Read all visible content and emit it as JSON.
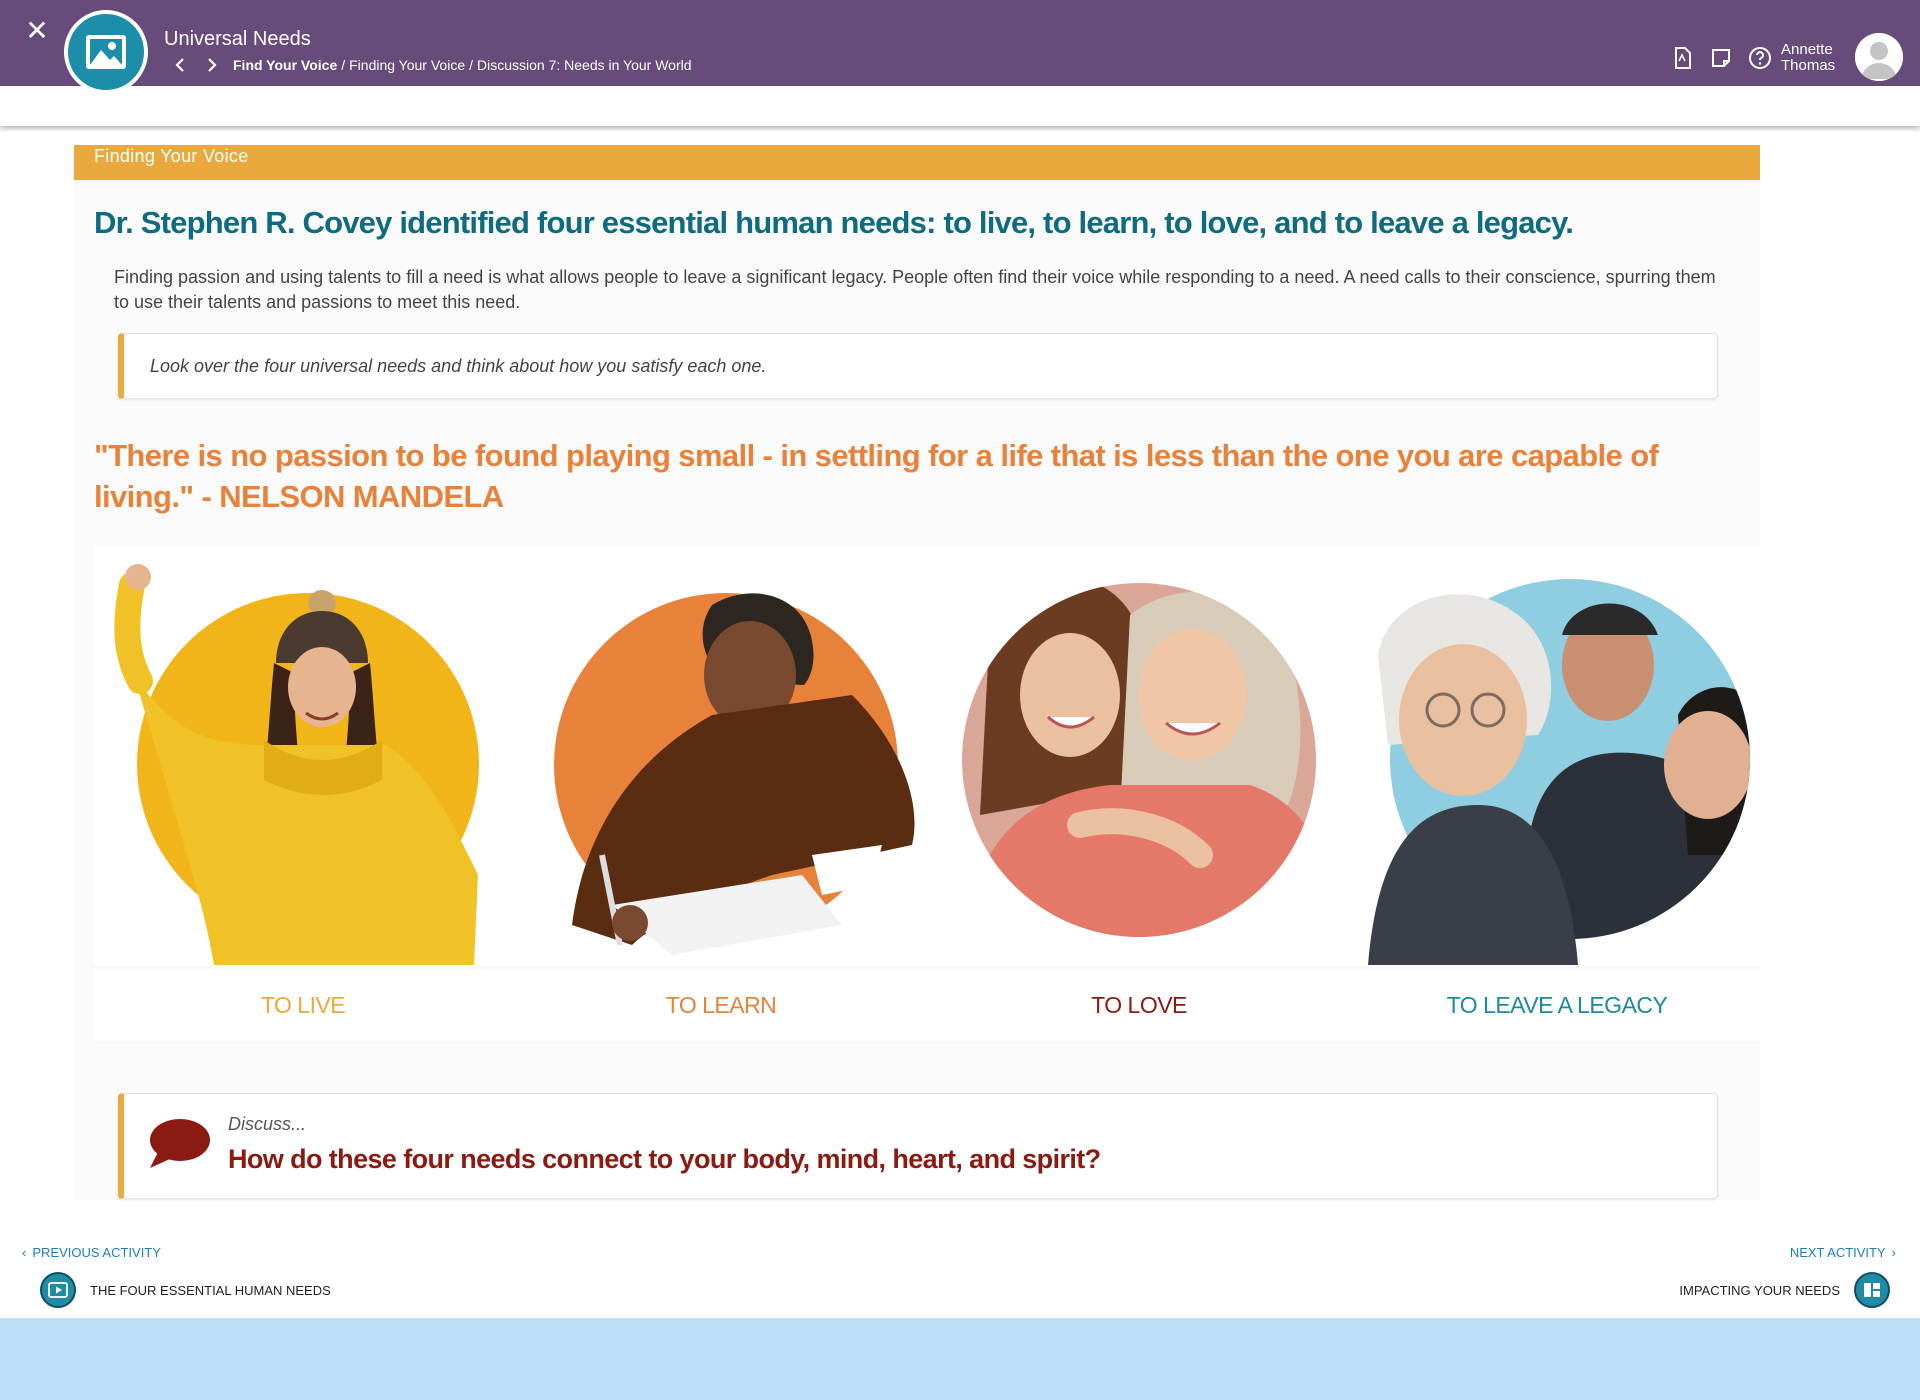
{
  "header": {
    "title": "Universal Needs",
    "breadcrumb": [
      "Find Your Voice",
      "Finding Your Voice",
      "Discussion 7: Needs in Your World"
    ],
    "user": {
      "first_name": "Annette",
      "last_name": "Thomas"
    }
  },
  "section": {
    "title": "Finding Your Voice"
  },
  "main": {
    "headline": "Dr. Stephen R. Covey identified four essential human needs: to live, to learn, to love, and to leave a legacy.",
    "intro": "Finding passion and using talents to fill a need is what allows people to leave a significant legacy. People often find their voice while responding to a need. A need calls to their conscience, spurring them to use their talents and passions to meet this need.",
    "callout": "Look over the four universal needs and think about how you satisfy each one.",
    "quote": "\"There is no passion to be found playing small - in settling for a life that is less than the one you are capable of living.\" - NELSON MANDELA",
    "needs": [
      {
        "label": "TO LIVE",
        "color": "#eaa93c",
        "circle_color": "#f2b519"
      },
      {
        "label": "TO LEARN",
        "color": "#e8823b",
        "circle_color": "#e8823b"
      },
      {
        "label": "TO LOVE",
        "color": "#8b1a12",
        "circle_color": "#d9a698"
      },
      {
        "label": "TO LEAVE A LEGACY",
        "color": "#1a8aa3",
        "circle_color": "#8fcde0"
      }
    ],
    "discuss": {
      "label": "Discuss...",
      "question": "How do these four needs connect to your body, mind, heart, and spirit?"
    }
  },
  "footer": {
    "previous": {
      "link_label": "PREVIOUS ACTIVITY",
      "title": "THE FOUR ESSENTIAL HUMAN NEEDS",
      "icon": "video-icon"
    },
    "next": {
      "link_label": "NEXT ACTIVITY",
      "title": "IMPACTING YOUR NEEDS",
      "icon": "card-sort-icon"
    }
  },
  "colors": {
    "topbar": "#674b7a",
    "section_bar": "#eaa93c",
    "headline": "#0f6c80",
    "quote": "#e8823b",
    "link": "#1a7fbf",
    "bottom_band": "#bcdff7"
  }
}
